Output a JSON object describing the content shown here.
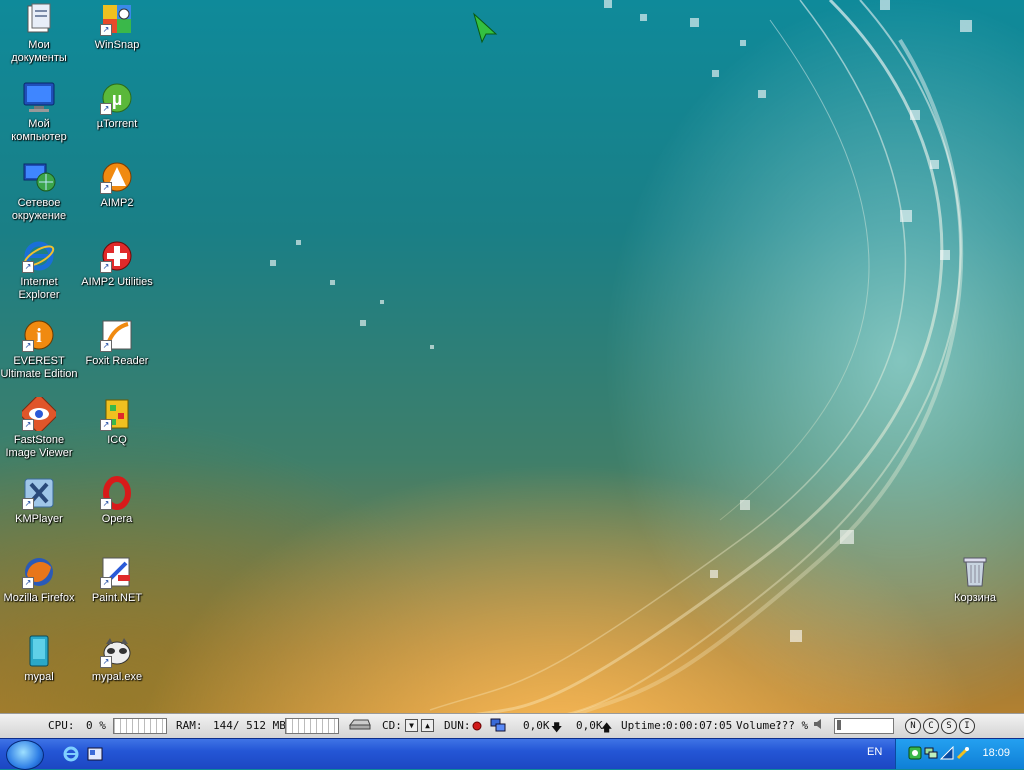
{
  "desktop": {
    "icons_left": [
      {
        "label": "Мои документы",
        "icon": "my-documents-icon"
      },
      {
        "label": "Мой компьютер",
        "icon": "my-computer-icon"
      },
      {
        "label": "Сетевое окружение",
        "icon": "network-places-icon"
      },
      {
        "label": "Internet Explorer",
        "icon": "internet-explorer-icon"
      },
      {
        "label": "EVEREST Ultimate Edition",
        "icon": "everest-icon"
      },
      {
        "label": "FastStone Image Viewer",
        "icon": "faststone-icon"
      },
      {
        "label": "KMPlayer",
        "icon": "kmplayer-icon"
      },
      {
        "label": "Mozilla Firefox",
        "icon": "firefox-icon"
      },
      {
        "label": "mypal",
        "icon": "mypal-icon"
      }
    ],
    "icons_right": [
      {
        "label": "WinSnap",
        "icon": "winsnap-icon"
      },
      {
        "label": "µTorrent",
        "icon": "utorrent-icon"
      },
      {
        "label": "AIMP2",
        "icon": "aimp2-icon"
      },
      {
        "label": "AIMP2 Utilities",
        "icon": "aimp2-utilities-icon"
      },
      {
        "label": "Foxit Reader",
        "icon": "foxit-reader-icon"
      },
      {
        "label": "ICQ",
        "icon": "icq-icon"
      },
      {
        "label": "Opera",
        "icon": "opera-icon"
      },
      {
        "label": "Paint.NET",
        "icon": "paint-net-icon"
      },
      {
        "label": "mypal.exe",
        "icon": "mypal-exe-icon"
      }
    ],
    "recycle_bin": {
      "label": "Корзина",
      "icon": "recycle-bin-icon"
    }
  },
  "statusbar": {
    "cpu_label": "CPU:",
    "cpu_value": "0 %",
    "ram_label": "RAM:",
    "ram_value": "144/ 512 MB",
    "cd_label": "CD:",
    "dun_label": "DUN:",
    "down_value": "0,0K",
    "up_value": "0,0K",
    "uptime_label": "Uptime:",
    "uptime_value": "0:00:07:05",
    "volume_label": "Volume:",
    "volume_value": "??? %",
    "buttons": [
      "N",
      "C",
      "S",
      "I"
    ]
  },
  "taskbar": {
    "language": "EN",
    "clock": "18:09"
  },
  "colors": {
    "taskbar": "#2456d6",
    "tray": "#0f7fd6",
    "statusbar": "#e0e0e0"
  }
}
